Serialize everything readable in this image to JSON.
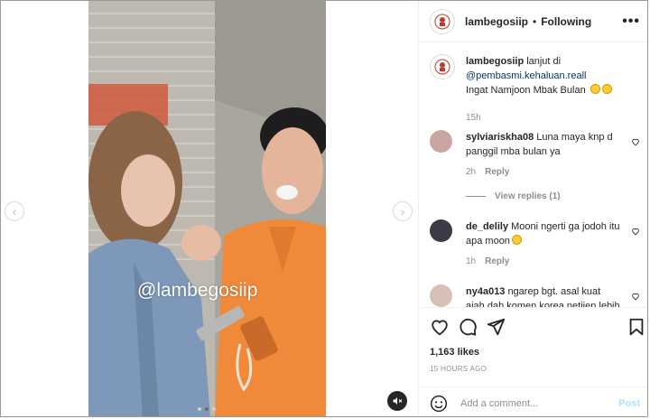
{
  "post": {
    "username": "lambegosiip",
    "separator": "•",
    "follow_status": "Following",
    "more_label": "•••",
    "watermark": "@lambegosiip",
    "caption": {
      "username": "lambegosiip",
      "text_before": "lanjut di",
      "mention": "@pembasmi.kehaluan.reall",
      "text_after": "Ingat Namjoon Mbak Bulan",
      "time": "15h"
    },
    "comments": [
      {
        "username": "sylviariskha08",
        "text": "Luna maya knp d panggil mba bulan ya",
        "time": "2h",
        "reply_label": "Reply",
        "view_replies": "View replies (1)",
        "avatar_color": "#c9a7a0"
      },
      {
        "username": "de_delily",
        "text": "Mooni ngerti ga jodoh itu apa moon",
        "time": "1h",
        "reply_label": "Reply",
        "avatar_color": "#3b3b47"
      },
      {
        "username": "ny4a013",
        "text": "ngarep bgt. asal kuat ajah dah komen korea netijen lebih",
        "avatar_color": "#d8c0b8"
      }
    ],
    "likes": "1,163 likes",
    "time_ago": "15 HOURS AGO",
    "add_comment_placeholder": "Add a comment...",
    "post_button": "Post"
  },
  "media": {
    "slide_count": 3,
    "active_slide": 2
  },
  "colors": {
    "link": "#00376b",
    "secondary_text": "#8e8e8e",
    "post_button_disabled": "#b2dffc"
  }
}
